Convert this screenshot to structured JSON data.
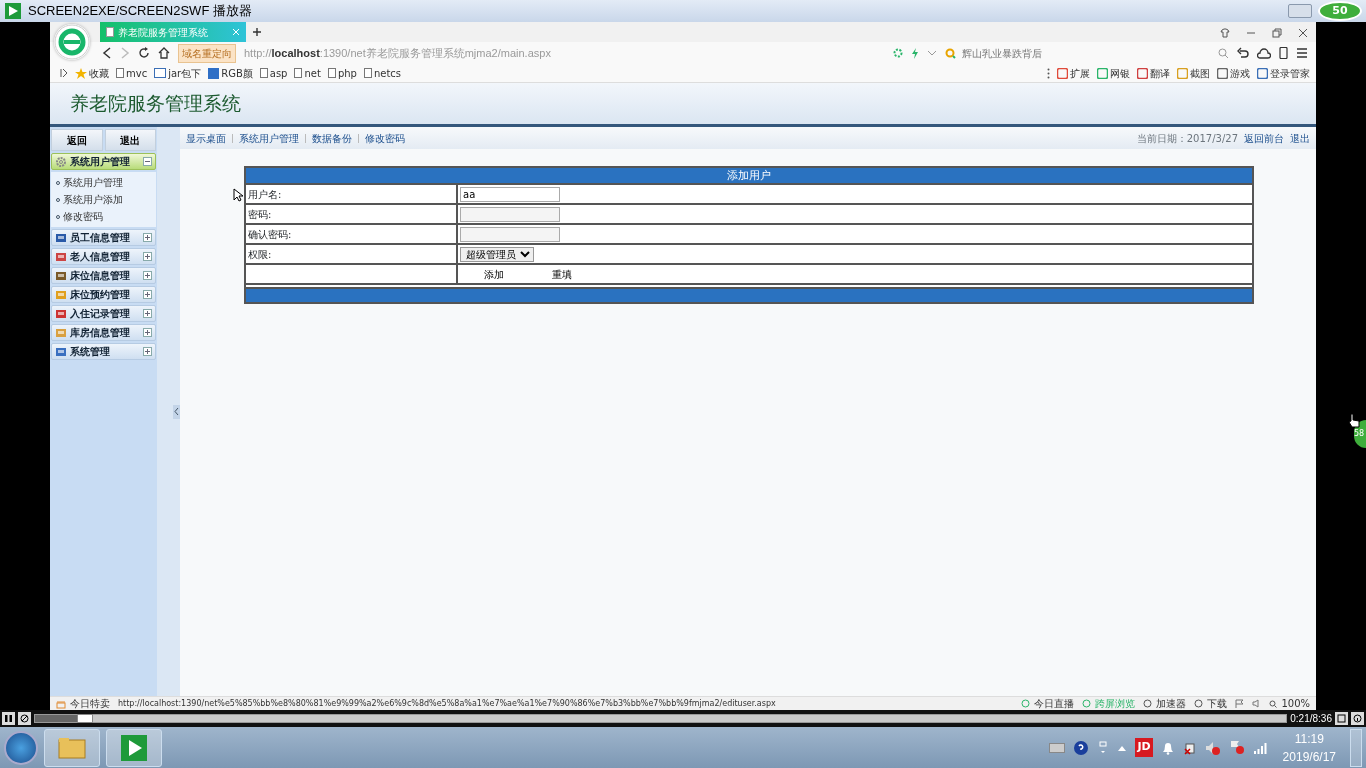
{
  "player": {
    "title": "SCREEN2EXE/SCREEN2SWF 播放器",
    "badge": "50",
    "side_badge": "58",
    "time": "0:21/8:36",
    "progress": {
      "level": 0.04
    }
  },
  "browser": {
    "tabs": [
      {
        "label": "养老院服务管理系统",
        "selected": true
      }
    ],
    "redirect_badge": "域名重定向",
    "url": "http://**localhost**:1390/net养老院服务管理系统mjma2/main.aspx",
    "search": {
      "placeholder": "辉山乳业暴跌背后"
    },
    "bookmarks": [
      "收藏",
      "mvc",
      "jar包下",
      "RGB颜",
      "asp",
      "net",
      "php",
      "netcs"
    ],
    "tools": [
      "扩展",
      "网银",
      "翻译",
      "截图",
      "游戏",
      "登录管家"
    ]
  },
  "app": {
    "title": "养老院服务管理系统",
    "top_buttons": [
      "返回",
      "退出"
    ],
    "menu": [
      {
        "label": "系统用户管理",
        "expanded": true,
        "children": [
          {
            "label": "系统用户管理"
          },
          {
            "label": "系统用户添加"
          },
          {
            "label": "修改密码"
          }
        ]
      },
      {
        "label": "员工信息管理",
        "expanded": false
      },
      {
        "label": "老人信息管理",
        "expanded": false
      },
      {
        "label": "床位信息管理",
        "expanded": false
      },
      {
        "label": "床位预约管理",
        "expanded": false
      },
      {
        "label": "入住记录管理",
        "expanded": false
      },
      {
        "label": "库房信息管理",
        "expanded": false
      },
      {
        "label": "系统管理",
        "expanded": false
      }
    ],
    "nav": [
      "显示桌面",
      "系统用户管理",
      "数据备份",
      "修改密码"
    ],
    "date": "当前日期：2017/3/27",
    "top_links": [
      "返回前台",
      "退出"
    ],
    "form": {
      "title": "添加用户",
      "rows": [
        {
          "label": "用户名:",
          "kind": "text",
          "value": "aa"
        },
        {
          "label": "密码:",
          "kind": "password"
        },
        {
          "label": "确认密码:",
          "kind": "password"
        },
        {
          "label": "权限:",
          "kind": "select",
          "value": "超级管理员"
        }
      ],
      "buttons": [
        "添加",
        "重填"
      ]
    }
  },
  "status": {
    "left": "今日特卖",
    "url": "http://localhost:1390/net%e5%85%bb%e8%80%81%e9%99%a2%e6%9c%8d%e5%8a%a1%e7%ae%a1%e7%90%86%e7%b3%bb%e7%bb%9fmjma2/edituser.aspx",
    "items": [
      "今日直播",
      "跨屏浏览",
      "加速器",
      "下载"
    ],
    "zoom": "100%"
  },
  "taskbar": {
    "tray_label": "JD",
    "time": "11:19",
    "date": "2019/6/17"
  }
}
